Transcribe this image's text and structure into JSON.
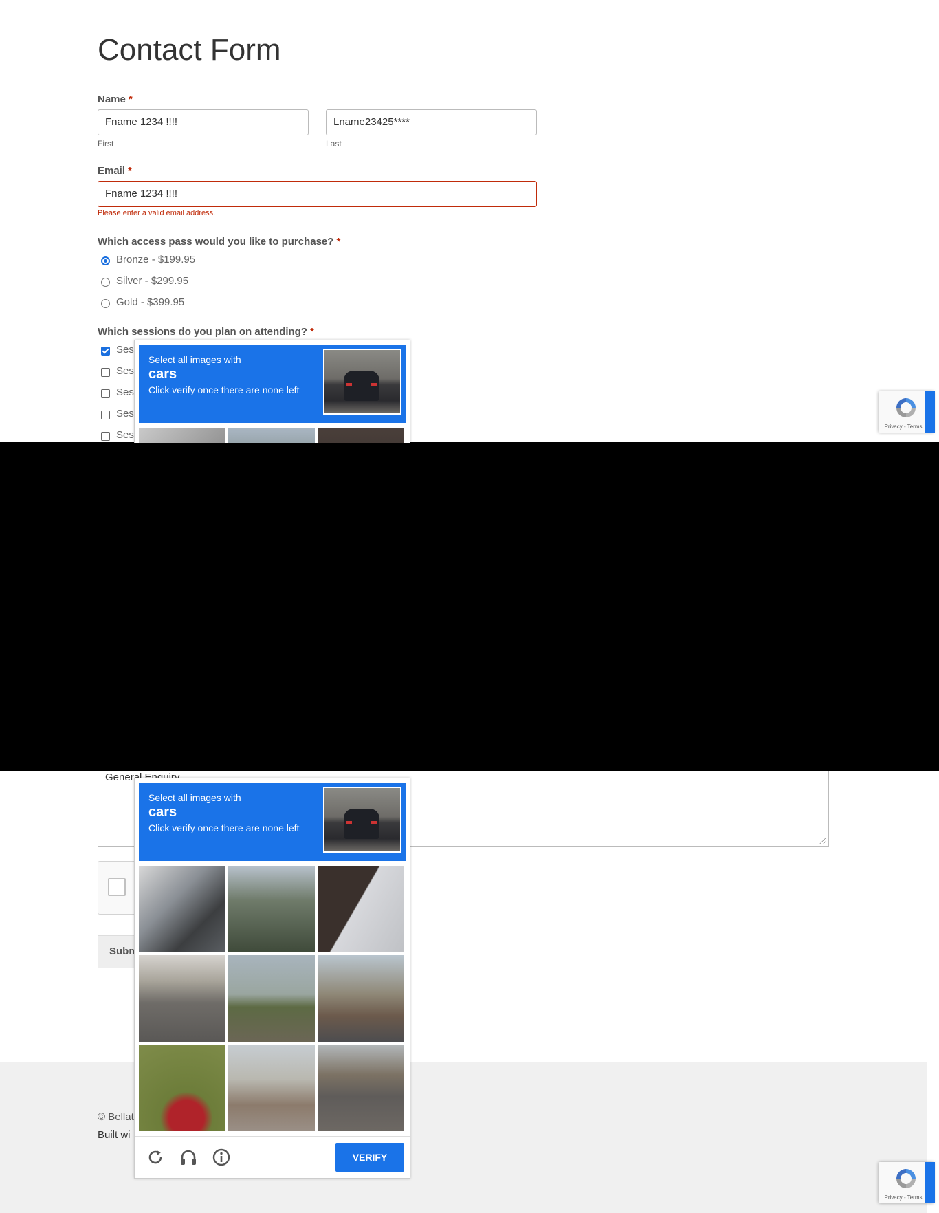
{
  "form": {
    "title": "Contact Form",
    "name": {
      "label": "Name",
      "required_mark": "*",
      "first_value": "Fname 1234    !!!!",
      "first_sublabel": "First",
      "last_value": "Lname23425****",
      "last_sublabel": "Last"
    },
    "email": {
      "label": "Email",
      "required_mark": "*",
      "value": "Fname 1234    !!!!",
      "error": "Please enter a valid email address."
    },
    "pass": {
      "label": "Which access pass would you like to purchase?",
      "required_mark": "*",
      "options": [
        {
          "label": "Bronze - $199.95",
          "selected": true
        },
        {
          "label": "Silver - $299.95",
          "selected": false
        },
        {
          "label": "Gold - $399.95",
          "selected": false
        }
      ]
    },
    "sessions": {
      "label": "Which sessions do you plan on attending?",
      "required_mark": "*",
      "items": [
        {
          "label": "Ses",
          "checked": true
        },
        {
          "label": "Ses",
          "checked": false
        },
        {
          "label": "Ses",
          "checked": false
        },
        {
          "label": "Ses",
          "checked": false
        },
        {
          "label": "Ses",
          "checked": false
        }
      ]
    },
    "message_value": "General Enquiry",
    "submit_label": "Subm"
  },
  "footer": {
    "copyright": "© Bellat",
    "built_with": "Built wi"
  },
  "recaptcha_badge": {
    "terms": "Privacy - Terms"
  },
  "challenge": {
    "line1": "Select all images with",
    "target": "cars",
    "line3": "Click verify once there are none left",
    "verify_label": "VERIFY",
    "icons": [
      "reload-icon",
      "audio-icon",
      "info-icon"
    ]
  }
}
